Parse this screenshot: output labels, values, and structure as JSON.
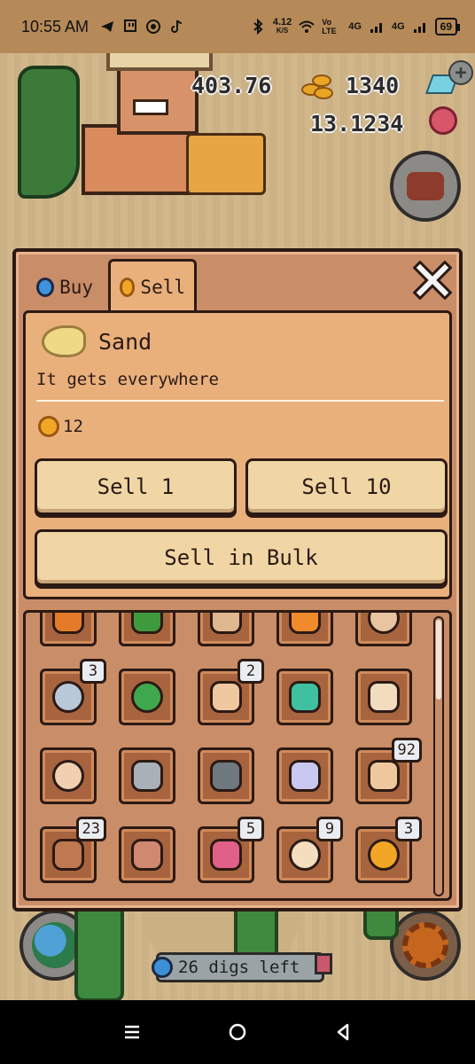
{
  "status_bar": {
    "time": "10:55 AM",
    "net_speed_value": "4.12",
    "net_speed_unit": "K/S",
    "volte": "Vo LTE",
    "signal_1": "4G",
    "signal_2": "4G",
    "battery": "69"
  },
  "hud": {
    "value_1": "403.76",
    "value_2": "1340",
    "value_3": "13.1234",
    "plus": "+"
  },
  "shop": {
    "tabs": [
      {
        "label": "Buy",
        "icon": "pin-icon"
      },
      {
        "label": "Sell",
        "icon": "coins-icon"
      }
    ],
    "active_tab": "Sell",
    "item": {
      "name": "Sand",
      "description": "It gets everywhere",
      "price": "12",
      "icon": "sand-icon"
    },
    "buttons": {
      "sell_1": "Sell 1",
      "sell_10": "Sell 10",
      "sell_bulk": "Sell in Bulk"
    },
    "inventory": [
      {
        "icon": "orange-gem-icon",
        "count": "",
        "color": "#e57a2a"
      },
      {
        "icon": "green-leaf-icon",
        "count": "",
        "color": "#3f9a3e"
      },
      {
        "icon": "shell-icon",
        "count": "",
        "color": "#e0b890"
      },
      {
        "icon": "starfish-icon",
        "count": "",
        "color": "#f08a2a"
      },
      {
        "icon": "compass-icon",
        "count": "",
        "color": "#e8c5a0"
      },
      {
        "icon": "compass-icon",
        "count": "3",
        "color": "#b9c8d8"
      },
      {
        "icon": "green-orb-icon",
        "count": "",
        "color": "#3fa84e"
      },
      {
        "icon": "clam-icon",
        "count": "2",
        "color": "#f0c8a0"
      },
      {
        "icon": "scarab-icon",
        "count": "",
        "color": "#3fc0a0"
      },
      {
        "icon": "bull-skull-icon",
        "count": "",
        "color": "#f2dcc0"
      },
      {
        "icon": "fossil-coin-icon",
        "count": "",
        "color": "#f0d0b0"
      },
      {
        "icon": "grey-rock-icon",
        "count": "",
        "color": "#a8b0b8"
      },
      {
        "icon": "dark-ore-icon",
        "count": "",
        "color": "#707880"
      },
      {
        "icon": "moonstone-icon",
        "count": "",
        "color": "#c8c8f0"
      },
      {
        "icon": "ammonite-icon",
        "count": "92",
        "color": "#f0c8a0"
      },
      {
        "icon": "clay-tablet-icon",
        "count": "23",
        "color": "#c07850"
      },
      {
        "icon": "clay-pot-icon",
        "count": "",
        "color": "#d08870"
      },
      {
        "icon": "pink-flower-icon",
        "count": "5",
        "color": "#e06088"
      },
      {
        "icon": "pearl-icon",
        "count": "9",
        "color": "#f5ddc0"
      },
      {
        "icon": "coin-pile-icon",
        "count": "3",
        "color": "#f2a626"
      }
    ]
  },
  "digs": {
    "label": "26 digs left"
  },
  "colors": {
    "panel": "#c98d68",
    "panel_light": "#e9b07c",
    "button": "#f0d6a4",
    "outline": "#2b1a14"
  }
}
